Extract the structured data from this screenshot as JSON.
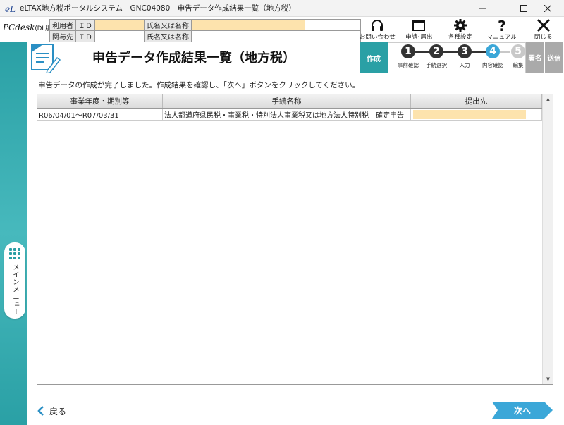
{
  "window": {
    "title": "eLTAX地方税ポータルシステム　GNC04080　申告データ作成結果一覧（地方税）"
  },
  "header": {
    "logo": "PCdesk",
    "logo_suffix": "(DL版)",
    "info": {
      "user_label": "利用者",
      "user_id_label": "ＩＤ",
      "user_name_label": "氏名又は名称",
      "related_label": "関与先",
      "related_id_label": "ＩＤ",
      "related_name_label": "氏名又は名称"
    },
    "tools": [
      {
        "label": "お問い合わせ",
        "icon": "headset-icon"
      },
      {
        "label": "申請･届出",
        "icon": "window-icon"
      },
      {
        "label": "各種設定",
        "icon": "gear-icon"
      },
      {
        "label": "マニュアル",
        "icon": "question-icon"
      },
      {
        "label": "閉じる",
        "icon": "close-icon"
      }
    ]
  },
  "sidebar": {
    "main_menu_label": "メインメニュー"
  },
  "page": {
    "title": "申告データ作成結果一覧（地方税）",
    "message": "申告データの作成が完了しました。作成結果を確認し、「次へ」ボタンをクリックしてください。"
  },
  "stepper": {
    "current_tab": "作成",
    "steps": [
      {
        "num": "1",
        "label": "事前確認",
        "state": "done"
      },
      {
        "num": "2",
        "label": "手続選択",
        "state": "done"
      },
      {
        "num": "3",
        "label": "入力",
        "state": "done"
      },
      {
        "num": "4",
        "label": "内容確認",
        "state": "current"
      },
      {
        "num": "5",
        "label": "編集",
        "state": "todo"
      }
    ],
    "next_tabs": [
      "署名",
      "送信"
    ]
  },
  "table": {
    "columns": [
      "事業年度・期別等",
      "手続名称",
      "提出先"
    ],
    "rows": [
      {
        "period": "R06/04/01～R07/03/31",
        "procedure": "法人都道府県民税・事業税・特別法人事業税又は地方法人特別税　確定申告",
        "destination": ""
      }
    ]
  },
  "footer": {
    "back_label": "戻る",
    "next_label": "次へ"
  },
  "colors": {
    "accent": "#2aa0a5",
    "step_done": "#333333",
    "step_current": "#3ba7d8",
    "step_todo": "#c8c8c8",
    "masked_field": "#fde3ad",
    "next_button": "#3ba7d8"
  }
}
